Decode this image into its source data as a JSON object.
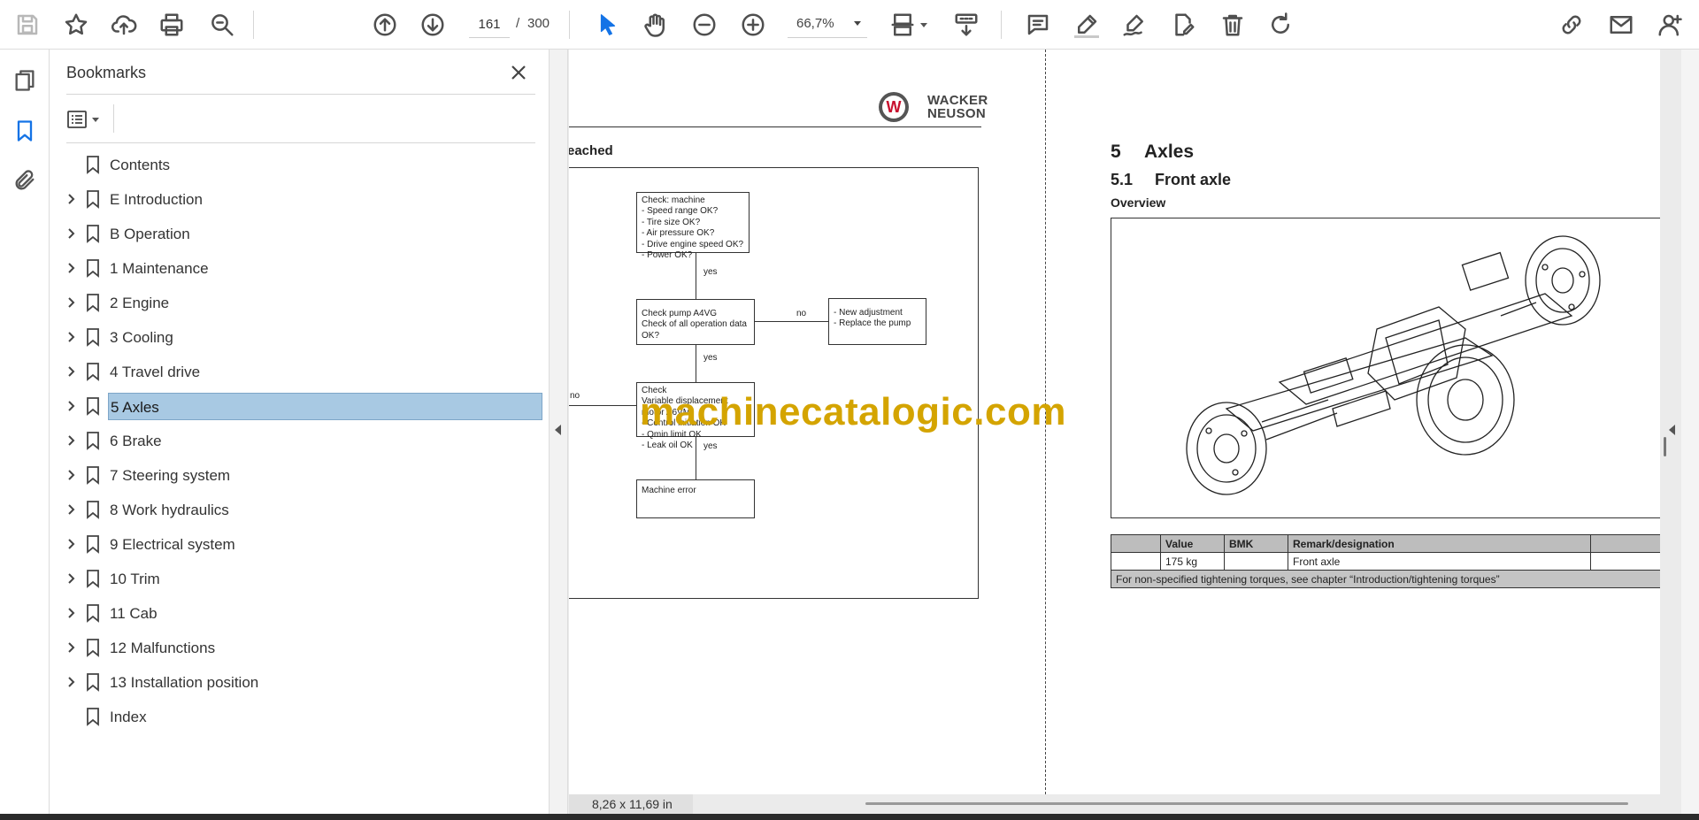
{
  "toolbar": {
    "page_current": "161",
    "page_separator": "/",
    "page_total": "300",
    "zoom": "66,7%",
    "icons": [
      "save-icon",
      "star-icon",
      "upload-icon",
      "print-icon",
      "find-icon",
      "page-up-icon",
      "page-down-icon",
      "select-cursor-icon",
      "hand-icon",
      "zoom-out-icon",
      "zoom-in-icon",
      "fit-page-icon",
      "scroll-mode-icon",
      "comment-icon",
      "highlight-icon",
      "sign-icon",
      "edit-pdf-icon",
      "delete-icon",
      "rotate-icon",
      "share-link-icon",
      "email-icon",
      "account-icon"
    ]
  },
  "bookmarks": {
    "title": "Bookmarks",
    "items": [
      {
        "label": "Contents",
        "expandable": false,
        "selected": false
      },
      {
        "label": "E Introduction",
        "expandable": true,
        "selected": false
      },
      {
        "label": "B Operation",
        "expandable": true,
        "selected": false
      },
      {
        "label": "1 Maintenance",
        "expandable": true,
        "selected": false
      },
      {
        "label": "2 Engine",
        "expandable": true,
        "selected": false
      },
      {
        "label": "3 Cooling",
        "expandable": true,
        "selected": false
      },
      {
        "label": "4 Travel drive",
        "expandable": true,
        "selected": false
      },
      {
        "label": "5 Axles",
        "expandable": true,
        "selected": true
      },
      {
        "label": "6 Brake",
        "expandable": true,
        "selected": false
      },
      {
        "label": "7 Steering system",
        "expandable": true,
        "selected": false
      },
      {
        "label": "8 Work hydraulics",
        "expandable": true,
        "selected": false
      },
      {
        "label": "9 Electrical system",
        "expandable": true,
        "selected": false
      },
      {
        "label": "10 Trim",
        "expandable": true,
        "selected": false
      },
      {
        "label": "11 Cab",
        "expandable": true,
        "selected": false
      },
      {
        "label": "12 Malfunctions",
        "expandable": true,
        "selected": false
      },
      {
        "label": "13 Installation position",
        "expandable": true,
        "selected": false
      },
      {
        "label": "Index",
        "expandable": false,
        "selected": false
      }
    ]
  },
  "left_page": {
    "logo_line1": "WACKER",
    "logo_line2": "NEUSON",
    "logo_mark": "W",
    "section_fragment": "eached",
    "flow": {
      "box1": "Check: machine\n- Speed range OK?\n- Tire size OK?\n- Air pressure OK?\n- Drive engine speed OK?\n- Power OK?",
      "box2": "Check pump A4VG\nCheck of all operation data OK?",
      "box3": "- New adjustment\n- Replace the pump",
      "box4": "Check\nVariable displacement motor A6VM\n- Control initiation OK\n- Qmin limit OK\n- Leak oil OK",
      "box5": "Machine error",
      "yes1": "yes",
      "yes2": "yes",
      "yes3": "yes",
      "no1": "no",
      "no2": "no"
    }
  },
  "watermark": "machinecatalogic.com",
  "right_page": {
    "chapter_num": "5",
    "chapter_title": "Axles",
    "section_num": "5.1",
    "section_title": "Front axle",
    "subheading": "Overview",
    "table": {
      "headers": [
        "",
        "Value",
        "BMK",
        "Remark/designation",
        ""
      ],
      "row": [
        "",
        "175 kg",
        "",
        "Front axle",
        ""
      ],
      "note": "For non-specified tightening torques, see chapter “Introduction/tightening torques”"
    }
  },
  "status": {
    "page_size": "8,26 x 11,69 in"
  },
  "colors": {
    "accent": "#1473e6",
    "selection": "#a8c9e3",
    "watermark": "#d4a400"
  }
}
